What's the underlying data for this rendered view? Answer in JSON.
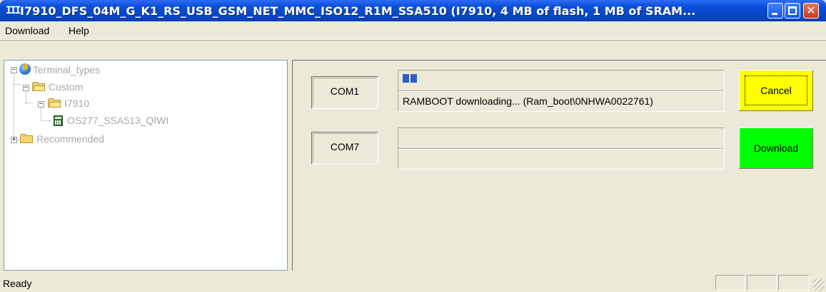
{
  "window": {
    "app_icon_glyph": "III",
    "title": "I7910_DFS_04M_G_K1_RS_USB_GSM_NET_MMC_ISO12_R1M_SSA510 (I7910, 4 MB of flash, 1 MB of SRAM...",
    "close_glyph": "✕"
  },
  "menu": {
    "download": "Download",
    "help": "Help"
  },
  "tree": {
    "root": {
      "label": "Terminal_types",
      "icon": "globe-icon",
      "expander": "−"
    },
    "custom": {
      "label": "Custom",
      "icon": "folder-open-icon",
      "expander": "−"
    },
    "i7910": {
      "label": "I7910",
      "icon": "folder-open-icon",
      "expander": "−"
    },
    "terminal": {
      "label": "OS277_SSA513_QIWI",
      "icon": "calculator-icon"
    },
    "recommended": {
      "label": "Recommended",
      "icon": "folder-icon",
      "expander": "+"
    }
  },
  "ports": [
    {
      "com_label": "COM1",
      "status": "RAMBOOT downloading... (Ram_boot\\0NHWA0022761)",
      "progress": 0.04,
      "progress_color": "#2f5ec4",
      "action_label": "Cancel",
      "action_color": "#ffff00"
    },
    {
      "com_label": "COM7",
      "status": "",
      "progress": 0,
      "action_label": "Download",
      "action_color": "#00ff00"
    }
  ],
  "statusbar": {
    "text": "Ready"
  },
  "colors": {
    "titlebar": "#0a4fd8",
    "window_bg": "#ece9d8",
    "tree_text_disabled": "#a8a8a8"
  }
}
